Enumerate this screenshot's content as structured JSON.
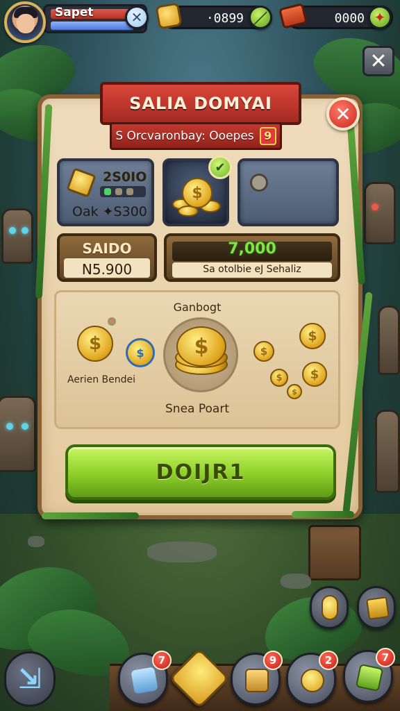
{
  "hud": {
    "player_name": "Sapet",
    "coins_value": "·0899",
    "gifts_value": "0000"
  },
  "panel": {
    "title": "SALIA DOMYAI",
    "subtitle": "S Orcvaronbay: Ooepes",
    "subtitle_badge": "9",
    "slot_1": {
      "top_value": "2S0IO",
      "bottom_value": "Oak ✦S300"
    },
    "saldo": {
      "label": "SAIDO",
      "value": "N5.900"
    },
    "reward": {
      "value": "7,000",
      "subtext": "Sa otolbie eJ Sehaliz"
    },
    "coin_area": {
      "top_label": "Ganbogt",
      "left_label": "Aerien Bendei",
      "bottom_label": "Snea Poart"
    },
    "collect_button": "DOIJR1"
  },
  "dock": {
    "badges": [
      "7",
      "9",
      "2",
      "7"
    ]
  },
  "colors": {
    "banner_red": "#c4382d",
    "panel_parchment": "#efdcbc",
    "button_green": "#8ccf2a",
    "gold": "#e0a51d",
    "badge_red": "#c51d13"
  },
  "icons": {
    "close_top": "close-icon",
    "close_panel": "close-icon",
    "back": "back-arrow-icon",
    "coin": "coin-icon",
    "gift": "gift-box-icon"
  }
}
